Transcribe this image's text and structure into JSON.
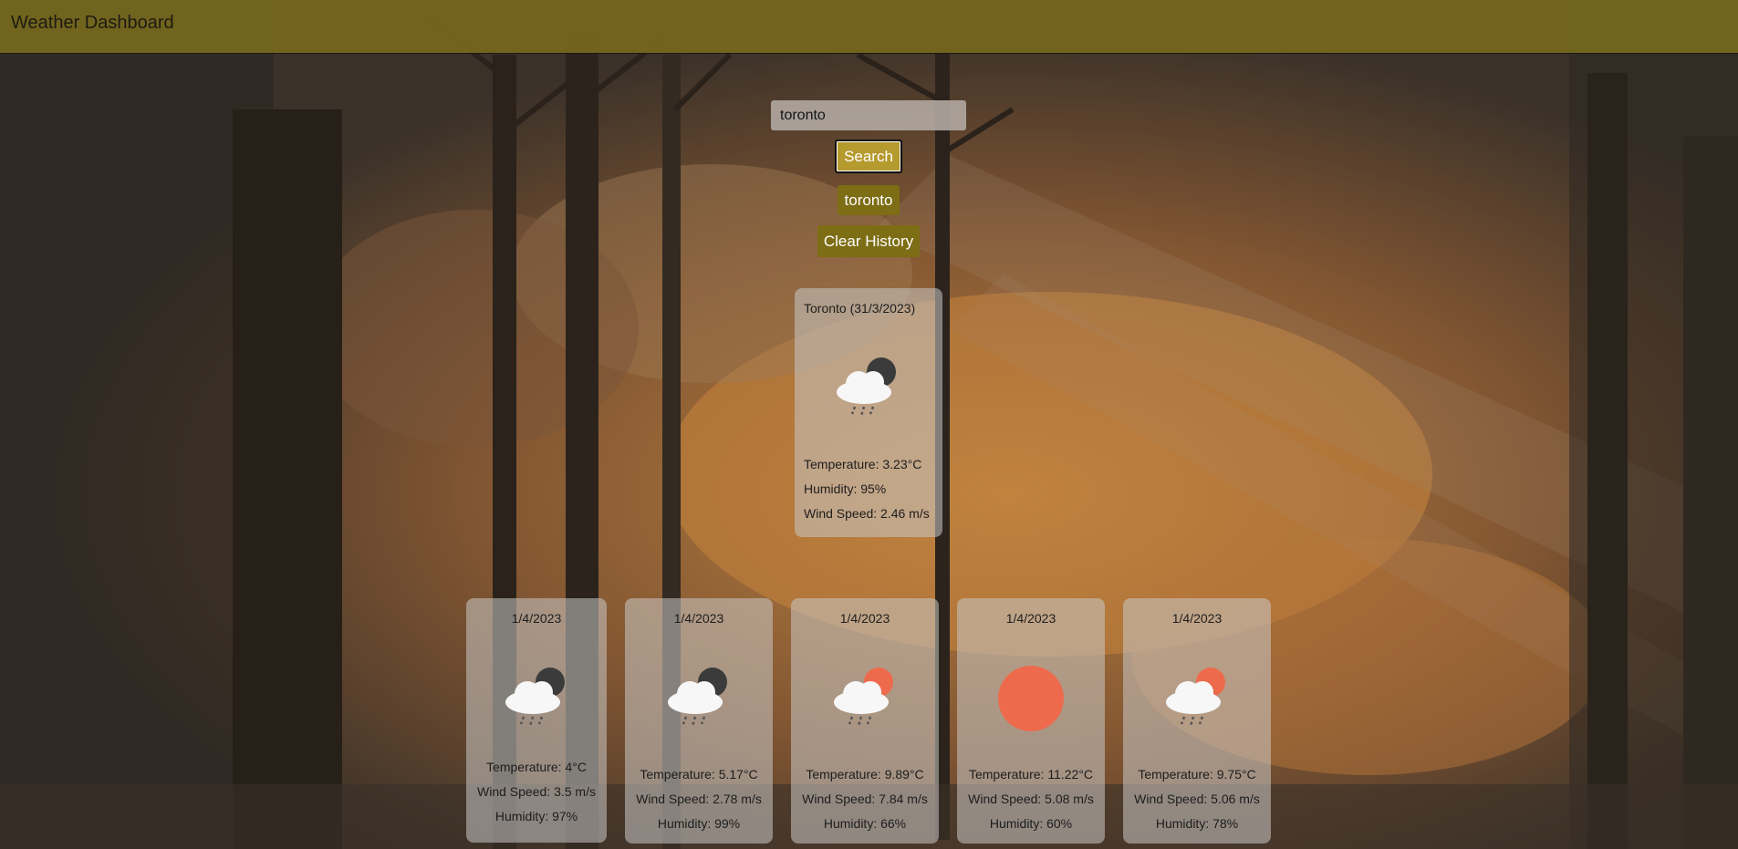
{
  "header": {
    "title": "Weather Dashboard"
  },
  "search": {
    "value": "toronto",
    "button_label": "Search"
  },
  "history": {
    "items": [
      "toronto"
    ],
    "clear_label": "Clear History"
  },
  "current": {
    "heading": "Toronto (31/3/2023)",
    "icon": "cloud-rain-night-icon",
    "temperature": "Temperature: 3.23°C",
    "humidity": "Humidity: 95%",
    "wind": "Wind Speed: 2.46 m/s"
  },
  "forecast": [
    {
      "date": "1/4/2023",
      "icon": "cloud-rain-night-icon",
      "temperature": "Temperature: 4°C",
      "wind": "Wind Speed: 3.5 m/s",
      "humidity": "Humidity: 97%"
    },
    {
      "date": "1/4/2023",
      "icon": "cloud-rain-night-icon",
      "temperature": "Temperature: 5.17°C",
      "wind": "Wind Speed: 2.78 m/s",
      "humidity": "Humidity: 99%"
    },
    {
      "date": "1/4/2023",
      "icon": "cloud-rain-sun-icon",
      "temperature": "Temperature: 9.89°C",
      "wind": "Wind Speed: 7.84 m/s",
      "humidity": "Humidity: 66%"
    },
    {
      "date": "1/4/2023",
      "icon": "sun-icon",
      "temperature": "Temperature: 11.22°C",
      "wind": "Wind Speed: 5.08 m/s",
      "humidity": "Humidity: 60%"
    },
    {
      "date": "1/4/2023",
      "icon": "cloud-rain-sun-icon",
      "temperature": "Temperature: 9.75°C",
      "wind": "Wind Speed: 5.06 m/s",
      "humidity": "Humidity: 78%"
    }
  ],
  "colors": {
    "header": "#76681e",
    "button_search": "#b59a2e",
    "button_olive": "#7d6d14",
    "sun": "#ee6a4c",
    "moon": "#3b3b3b"
  }
}
